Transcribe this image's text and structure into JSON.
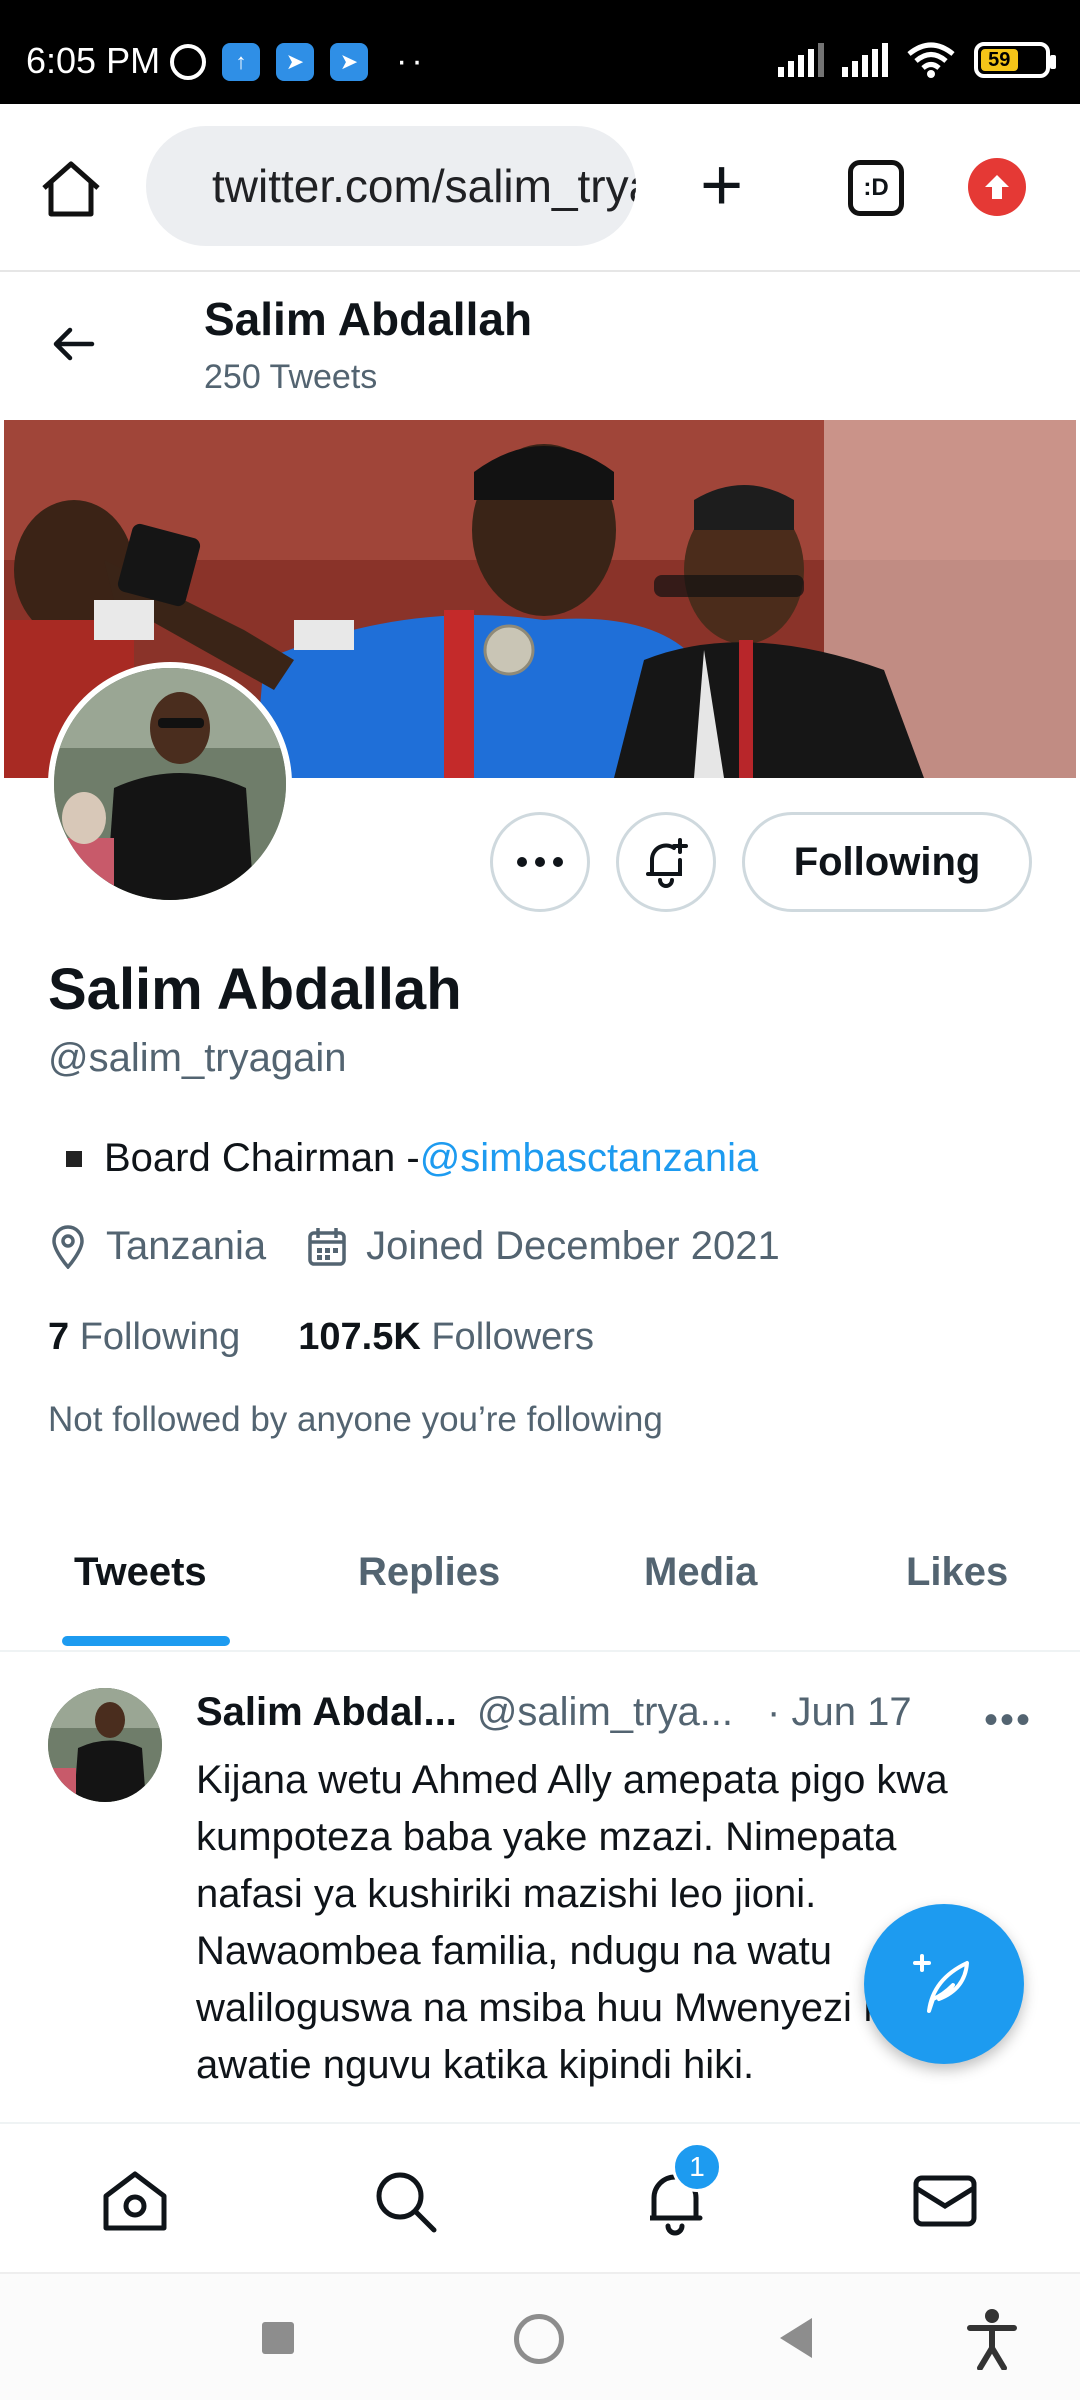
{
  "status_bar": {
    "time": "6:05 PM",
    "battery": "59"
  },
  "browser": {
    "url": "twitter.com/salim_tryagain",
    "tabs_icon_label": ":D"
  },
  "profile_header": {
    "name": "Salim Abdallah",
    "tweet_count": "250 Tweets"
  },
  "actions": {
    "following_label": "Following"
  },
  "profile": {
    "name": "Salim Abdallah",
    "handle": "@salim_tryagain",
    "bio_text": "Board Chairman - ",
    "bio_link": "@simbasctanzania",
    "location": "Tanzania",
    "joined": "Joined December 2021",
    "following_count": "7",
    "following_label": "Following",
    "followers_count": "107.5K",
    "followers_label": "Followers",
    "not_followed": "Not followed by anyone you’re following"
  },
  "tabs": [
    {
      "label": "Tweets",
      "active": true
    },
    {
      "label": "Replies"
    },
    {
      "label": "Media"
    },
    {
      "label": "Likes"
    }
  ],
  "tweet": {
    "name": "Salim Abdal...",
    "handle": "@salim_trya...",
    "date": "· Jun 17",
    "more": "•••",
    "lines": [
      "Kijana wetu Ahmed Ally amepata pigo kwa",
      "kumpoteza baba yake mzazi. Nimepata",
      "nafasi ya kushiriki mazishi leo jioni.",
      "Nawaombea familia, ndugu na watu",
      "waliloguswa na msiba huu Mwenyezi Mungu",
      "awatie nguvu katika kipindi hiki."
    ]
  },
  "bottom_nav": {
    "notification_badge": "1"
  },
  "colors": {
    "accent": "#1d9bf0",
    "text_primary": "#0f1419",
    "text_secondary": "#536471",
    "update_red": "#e53935"
  }
}
